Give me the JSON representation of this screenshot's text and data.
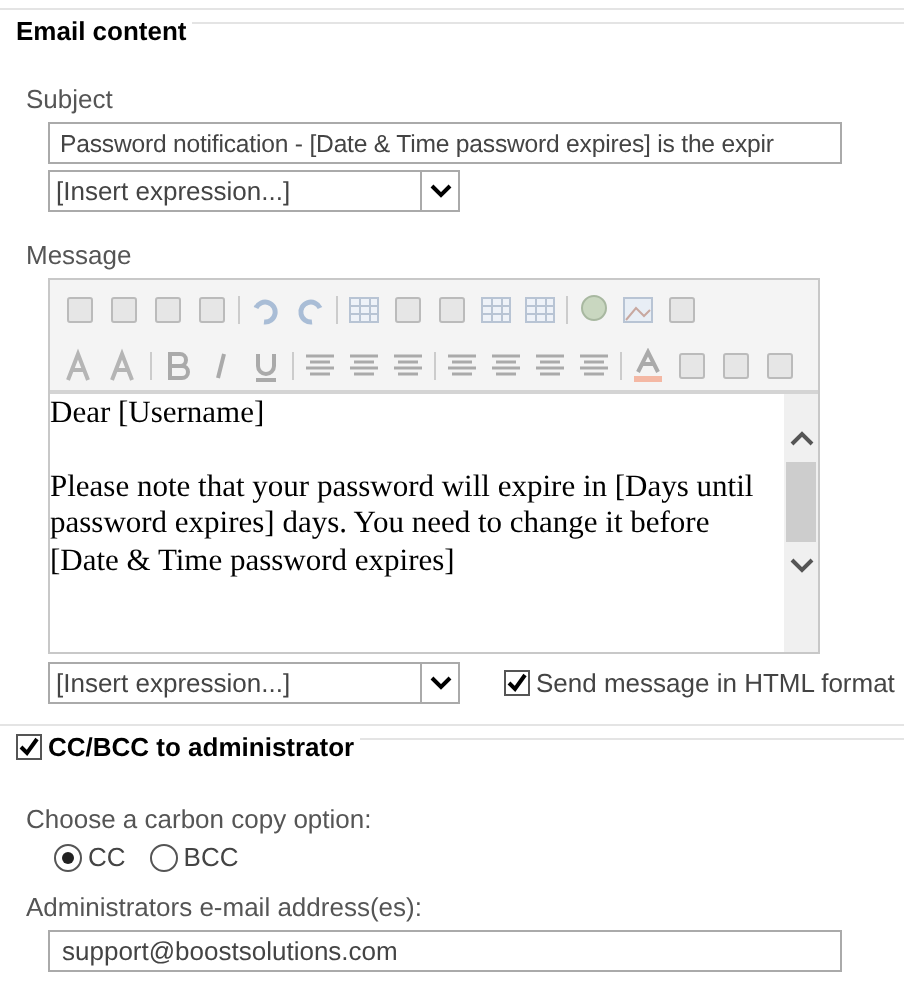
{
  "email_section": {
    "title": "Email content"
  },
  "subject": {
    "label": "Subject",
    "value": "Password notification - [Date & Time password expires] is the expir",
    "expression": "[Insert expression...]"
  },
  "message": {
    "label": "Message",
    "paragraphs": [
      "Dear [Username]",
      "Please note that your password will expire in [Days until password expires] days. You need to change it before [Date & Time password expires]"
    ],
    "expression": "[Insert expression...]",
    "html_format": {
      "label": "Send message in HTML format",
      "checked": true
    }
  },
  "cc_section": {
    "title": "CC/BCC to administrator",
    "checked": true
  },
  "cc_option": {
    "label": "Choose a carbon copy option:",
    "options": [
      {
        "label": "CC",
        "selected": true
      },
      {
        "label": "BCC",
        "selected": false
      }
    ]
  },
  "admin_email": {
    "label": "Administrators e-mail address(es):",
    "value": "support@boostsolutions.com"
  }
}
